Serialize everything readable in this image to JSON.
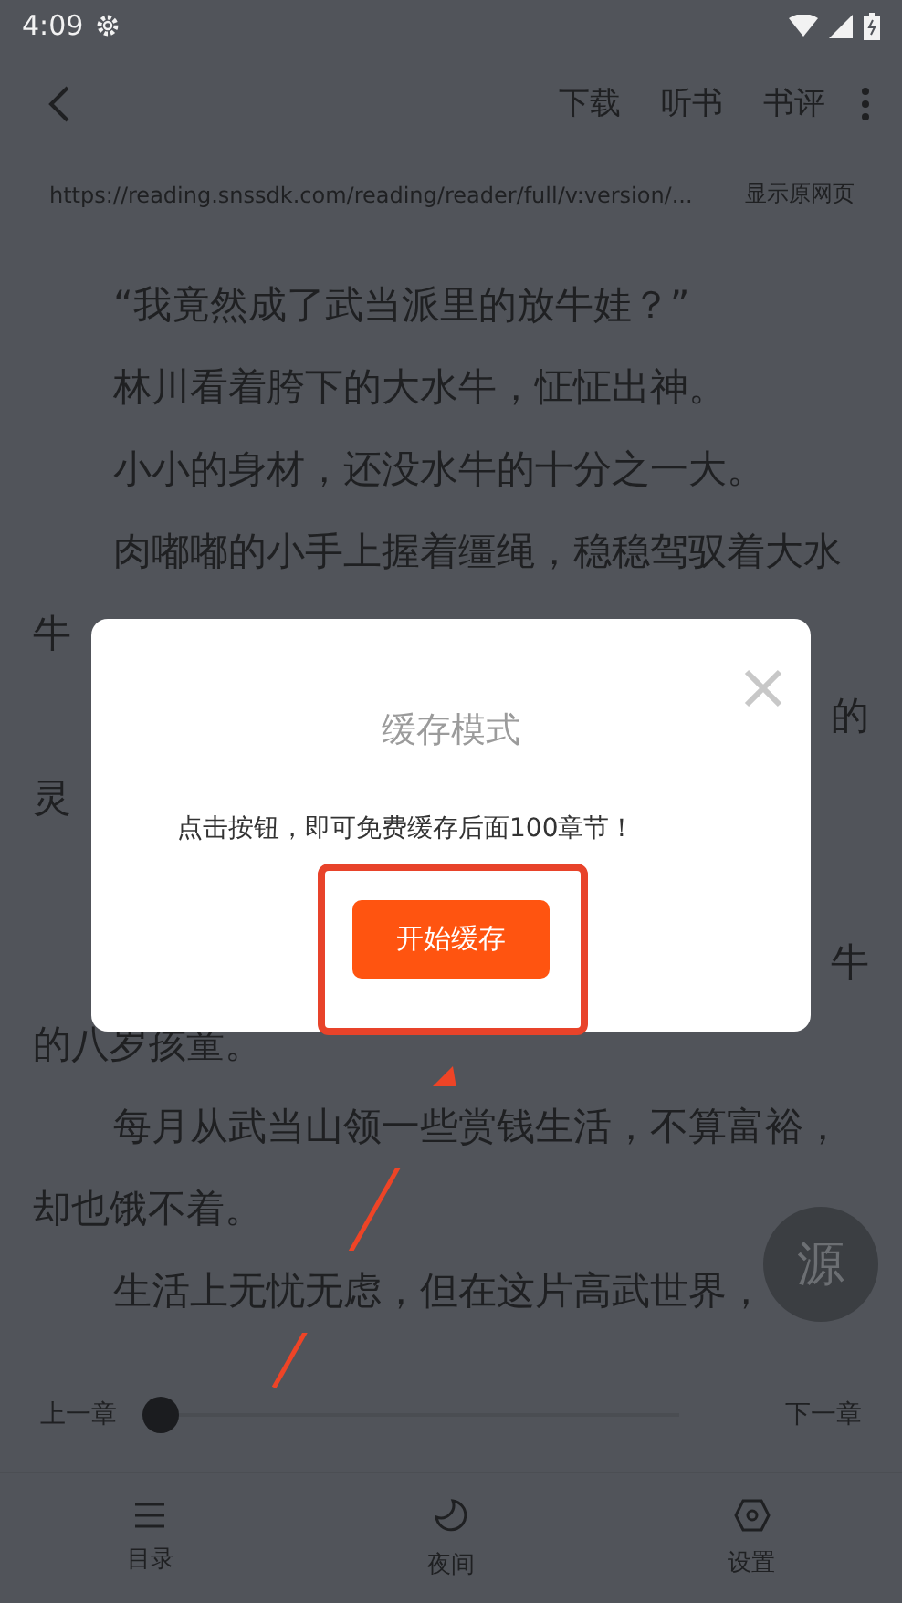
{
  "status_bar": {
    "time": "4:09"
  },
  "toolbar": {
    "actions": [
      "下载",
      "听书",
      "书评"
    ]
  },
  "url_bar": {
    "url": "https://reading.snssdk.com/reading/reader/full/v:version/...",
    "action": "显示原网页"
  },
  "story_lines": [
    {
      "kind": "full",
      "indent": true,
      "text": "“我竟然成了武当派里的放牛娃？”"
    },
    {
      "kind": "full",
      "indent": true,
      "text": "林川看着胯下的大水牛，怔怔出神。"
    },
    {
      "kind": "full",
      "indent": true,
      "text": "小小的身材，还没水牛的十分之一大。"
    },
    {
      "kind": "full",
      "indent": true,
      "text": "肉嘟嘟的小手上握着缰绳，稳稳驾驭着大水"
    },
    {
      "kind": "left",
      "text": "牛"
    },
    {
      "kind": "right",
      "text": "的"
    },
    {
      "kind": "left",
      "text": "灵"
    },
    {
      "kind": "gap"
    },
    {
      "kind": "right",
      "text": "牛"
    },
    {
      "kind": "full",
      "indent": false,
      "text": "的八岁孩童。"
    },
    {
      "kind": "full",
      "indent": true,
      "text": "每月从武当山领一些赏钱生活，不算富裕，"
    },
    {
      "kind": "full",
      "indent": false,
      "text": "却也饿不着。"
    },
    {
      "kind": "full",
      "indent": true,
      "text": "生活上无忧无虑，但在这片高武世界，"
    }
  ],
  "source_button": "源",
  "chapter_nav": {
    "previous": "上一章",
    "next": "下一章",
    "level": 0.0
  },
  "bottom_nav": [
    {
      "kind": "menu",
      "label": "目录"
    },
    {
      "kind": "moon",
      "label": "夜间"
    },
    {
      "kind": "hexagon",
      "label": "设置"
    }
  ],
  "dialog": {
    "title": "缓存模式",
    "message": "点击按钮，即可免费缓存后面100章节！",
    "button": "开始缓存"
  }
}
